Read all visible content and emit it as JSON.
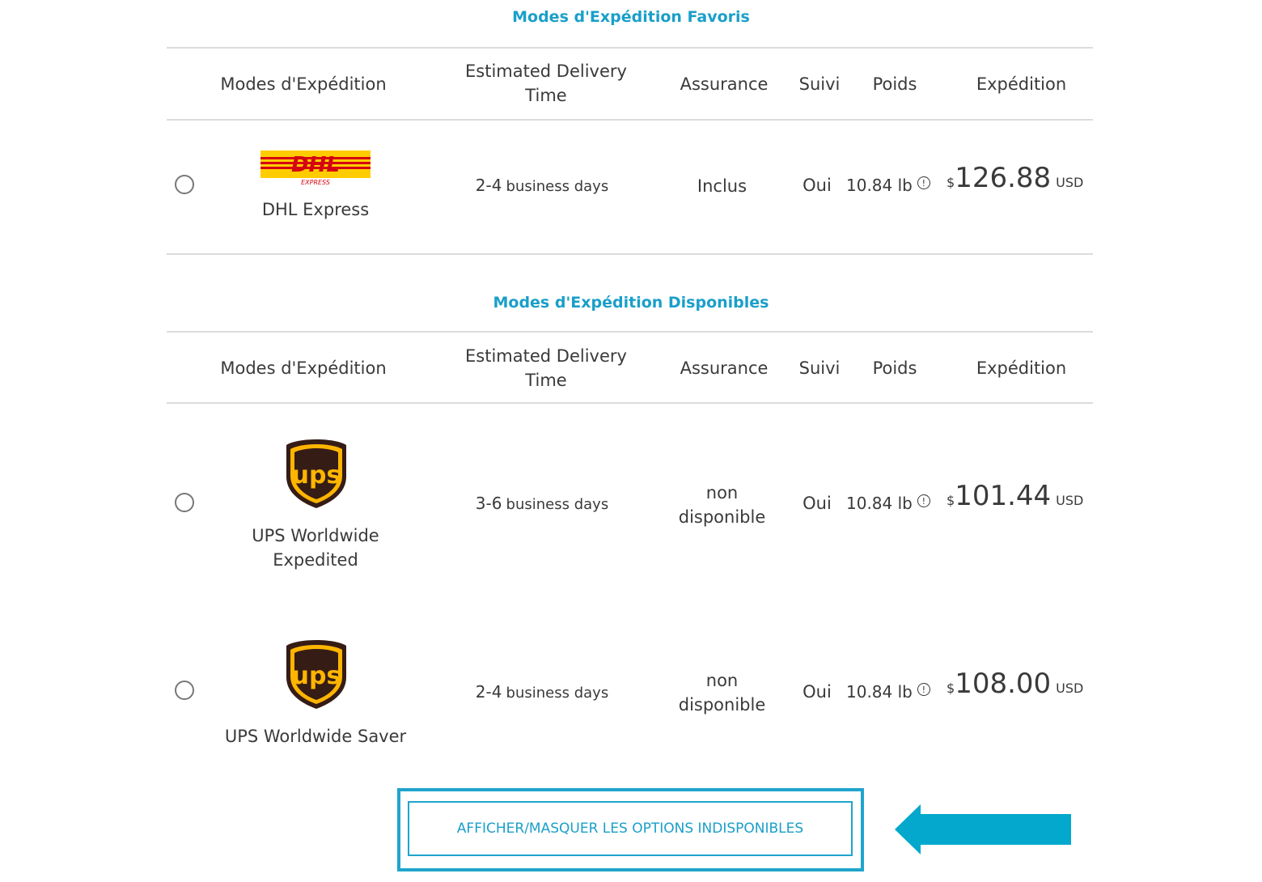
{
  "favorites": {
    "title": "Modes d'Expédition Favoris",
    "headers": {
      "method": "Modes d'Expédition",
      "delivery_line1": "Estimated Delivery",
      "delivery_line2": "Time",
      "insurance": "Assurance",
      "tracking": "Suivi",
      "weight": "Poids",
      "shipping": "Expédition"
    },
    "rows": [
      {
        "carrier": "DHL Express",
        "logo": "dhl-express-logo",
        "logo_text": "DHL",
        "logo_subtext": "EXPRESS",
        "delivery_num": "2-4",
        "delivery_unit": "business days",
        "insurance": "Inclus",
        "tracking": "Oui",
        "weight": "10.84 lb",
        "currency_symbol": "$",
        "price": "126.88",
        "currency": "USD"
      }
    ]
  },
  "available": {
    "title": "Modes d'Expédition Disponibles",
    "headers": {
      "method": "Modes d'Expédition",
      "delivery_line1": "Estimated Delivery",
      "delivery_line2": "Time",
      "insurance": "Assurance",
      "tracking": "Suivi",
      "weight": "Poids",
      "shipping": "Expédition"
    },
    "rows": [
      {
        "carrier_line1": "UPS Worldwide",
        "carrier_line2": "Expedited",
        "logo": "ups-logo",
        "logo_text": "ups",
        "delivery_num": "3-6",
        "delivery_unit": "business days",
        "insurance_line1": "non",
        "insurance_line2": "disponible",
        "tracking": "Oui",
        "weight": "10.84 lb",
        "currency_symbol": "$",
        "price": "101.44",
        "currency": "USD"
      },
      {
        "carrier": "UPS Worldwide Saver",
        "logo": "ups-logo",
        "logo_text": "ups",
        "delivery_num": "2-4",
        "delivery_unit": "business days",
        "insurance_line1": "non",
        "insurance_line2": "disponible",
        "tracking": "Oui",
        "weight": "10.84 lb",
        "currency_symbol": "$",
        "price": "108.00",
        "currency": "USD"
      }
    ]
  },
  "toggle_button": {
    "label": "AFFICHER/MASQUER LES OPTIONS INDISPONIBLES"
  },
  "info_icon_glyph": "!",
  "colors": {
    "accent": "#1a9fc9",
    "highlight": "#1fa5cc",
    "arrow": "#03a8cc",
    "dhl_yellow": "#ffcc00",
    "dhl_red": "#d40511",
    "ups_brown": "#351c15",
    "ups_gold": "#ffb500"
  }
}
